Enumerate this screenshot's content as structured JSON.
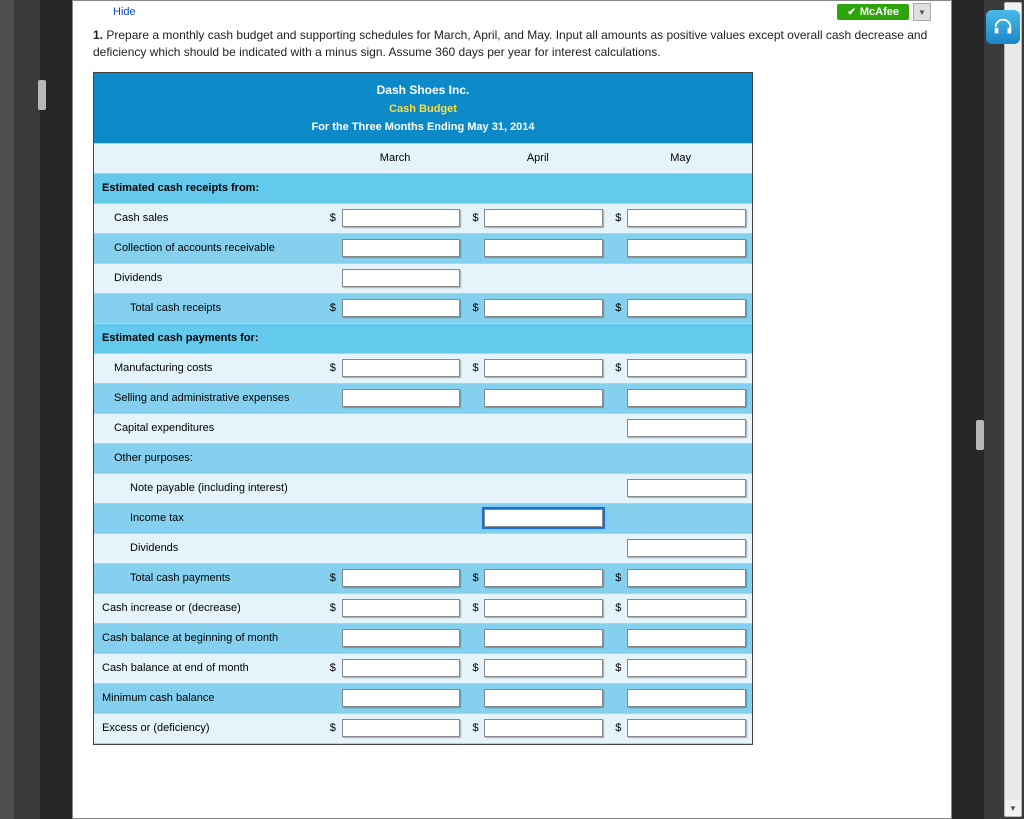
{
  "link": {
    "hide": "Hide"
  },
  "mcafee": {
    "label": "McAfee"
  },
  "problem": {
    "num": "1.",
    "text": "Prepare a monthly cash budget and supporting schedules for March, April, and May. Input all amounts as positive values except overall cash decrease and deficiency which should be indicated with a minus sign. Assume 360 days per year for interest calculations."
  },
  "header": {
    "company": "Dash Shoes Inc.",
    "report": "Cash Budget",
    "period": "For the Three Months Ending May 31, 2014"
  },
  "months": {
    "m1": "March",
    "m2": "April",
    "m3": "May"
  },
  "rows": {
    "receipts_from": "Estimated cash receipts from:",
    "cash_sales": "Cash sales",
    "collection_ar": "Collection of accounts receivable",
    "dividends_in": "Dividends",
    "total_receipts": "Total cash receipts",
    "payments_for": "Estimated cash payments for:",
    "mfg_costs": "Manufacturing costs",
    "sell_admin": "Selling and administrative expenses",
    "capex": "Capital expenditures",
    "other_purposes": "Other purposes:",
    "note_payable": "Note payable (including interest)",
    "income_tax": "Income tax",
    "dividends_out": "Dividends",
    "total_payments": "Total cash payments",
    "cash_incr": "Cash increase or (decrease)",
    "bal_begin": "Cash balance at beginning of month",
    "bal_end": "Cash balance at end of month",
    "min_bal": "Minimum cash balance",
    "excess": "Excess or (deficiency)"
  },
  "currency": "$"
}
